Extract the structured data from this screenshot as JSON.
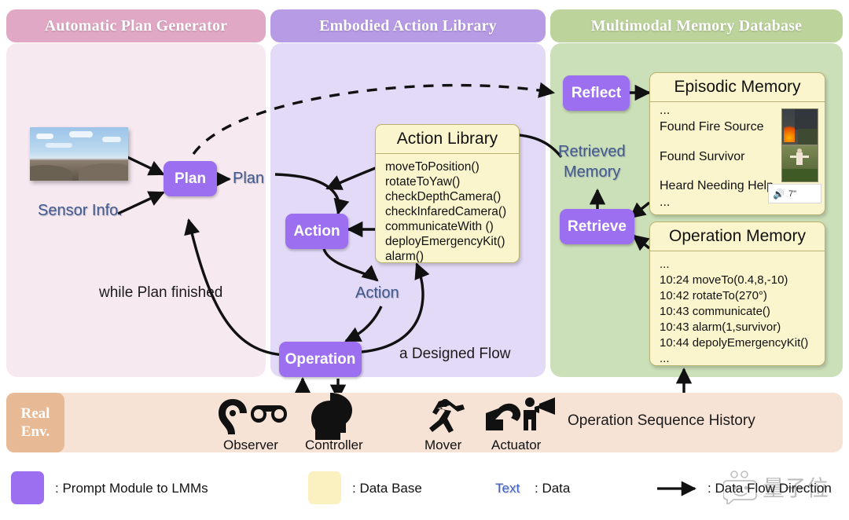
{
  "panels": [
    {
      "title": "Automatic Plan Generator",
      "header_color": "#e0a8c4",
      "body_color": "#f7e9f0"
    },
    {
      "title": "Embodied Action Library",
      "header_color": "#b79be4",
      "body_color": "#e3daf7"
    },
    {
      "title": "Multimodal Memory Database",
      "header_color": "#bcd39c",
      "body_color": "#cbdfb8"
    }
  ],
  "nodes": {
    "plan": "Plan",
    "action": "Action",
    "operation": "Operation",
    "reflect": "Reflect",
    "retrieve": "Retrieve"
  },
  "data_labels": {
    "sensor_info": "Sensor Info.",
    "plan": "Plan",
    "action": "Action",
    "retrieved_memory_line1": "Retrieved",
    "retrieved_memory_line2": "Memory"
  },
  "annotations": {
    "while_plan_finished": "while Plan finished",
    "a_designed_flow": "a Designed Flow",
    "operation_sequence_history": "Operation Sequence History"
  },
  "action_library": {
    "title": "Action Library",
    "items": [
      "moveToPosition()",
      "rotateToYaw()",
      "checkDepthCamera()",
      "checkInfaredCamera()",
      "communicateWith ()",
      "deployEmergencyKit()",
      "alarm()"
    ]
  },
  "episodic_memory": {
    "title": "Episodic Memory",
    "top_ellipsis": "...",
    "bottom_ellipsis": "...",
    "entries": [
      {
        "text": "Found Fire Source",
        "media": "fire-thumbnail"
      },
      {
        "text": "Found Survivor",
        "media": "survivor-thumbnail"
      },
      {
        "text": "Heard Needing Help",
        "media": "audio-clip",
        "duration": "7\""
      }
    ]
  },
  "operation_memory": {
    "title": "Operation Memory",
    "top_ellipsis": "...",
    "bottom_ellipsis": "...",
    "entries": [
      "10:24 moveTo(0.4,8,-10)",
      "10:42 rotateTo(270°)",
      "10:43 communicate()",
      "10:43 alarm(1,survivor)",
      "10:44 depolyEmergencyKit()"
    ]
  },
  "environment": {
    "badge_line1": "Real",
    "badge_line2": "Env.",
    "roles": [
      {
        "label": "Observer",
        "icons": [
          "ear-icon",
          "glasses-icon"
        ]
      },
      {
        "label": "Controller",
        "icons": [
          "brain-head-icon"
        ]
      },
      {
        "label": "Mover",
        "icons": [
          "running-person-icon"
        ]
      },
      {
        "label": "Actuator",
        "icons": [
          "flexed-bicep-icon",
          "megaphone-person-icon"
        ]
      }
    ]
  },
  "legend": [
    {
      "swatch": "#9b6ff0",
      "text": ": Prompt Module to LMMs",
      "kind": "swatch"
    },
    {
      "swatch": "#faf0c0",
      "text": ": Data Base",
      "kind": "swatch"
    },
    {
      "sample": "Text",
      "text": ": Data",
      "kind": "text",
      "color": "#3f62c4"
    },
    {
      "text": ": Data Flow Direction",
      "kind": "arrow"
    }
  ],
  "watermark": "量子位"
}
